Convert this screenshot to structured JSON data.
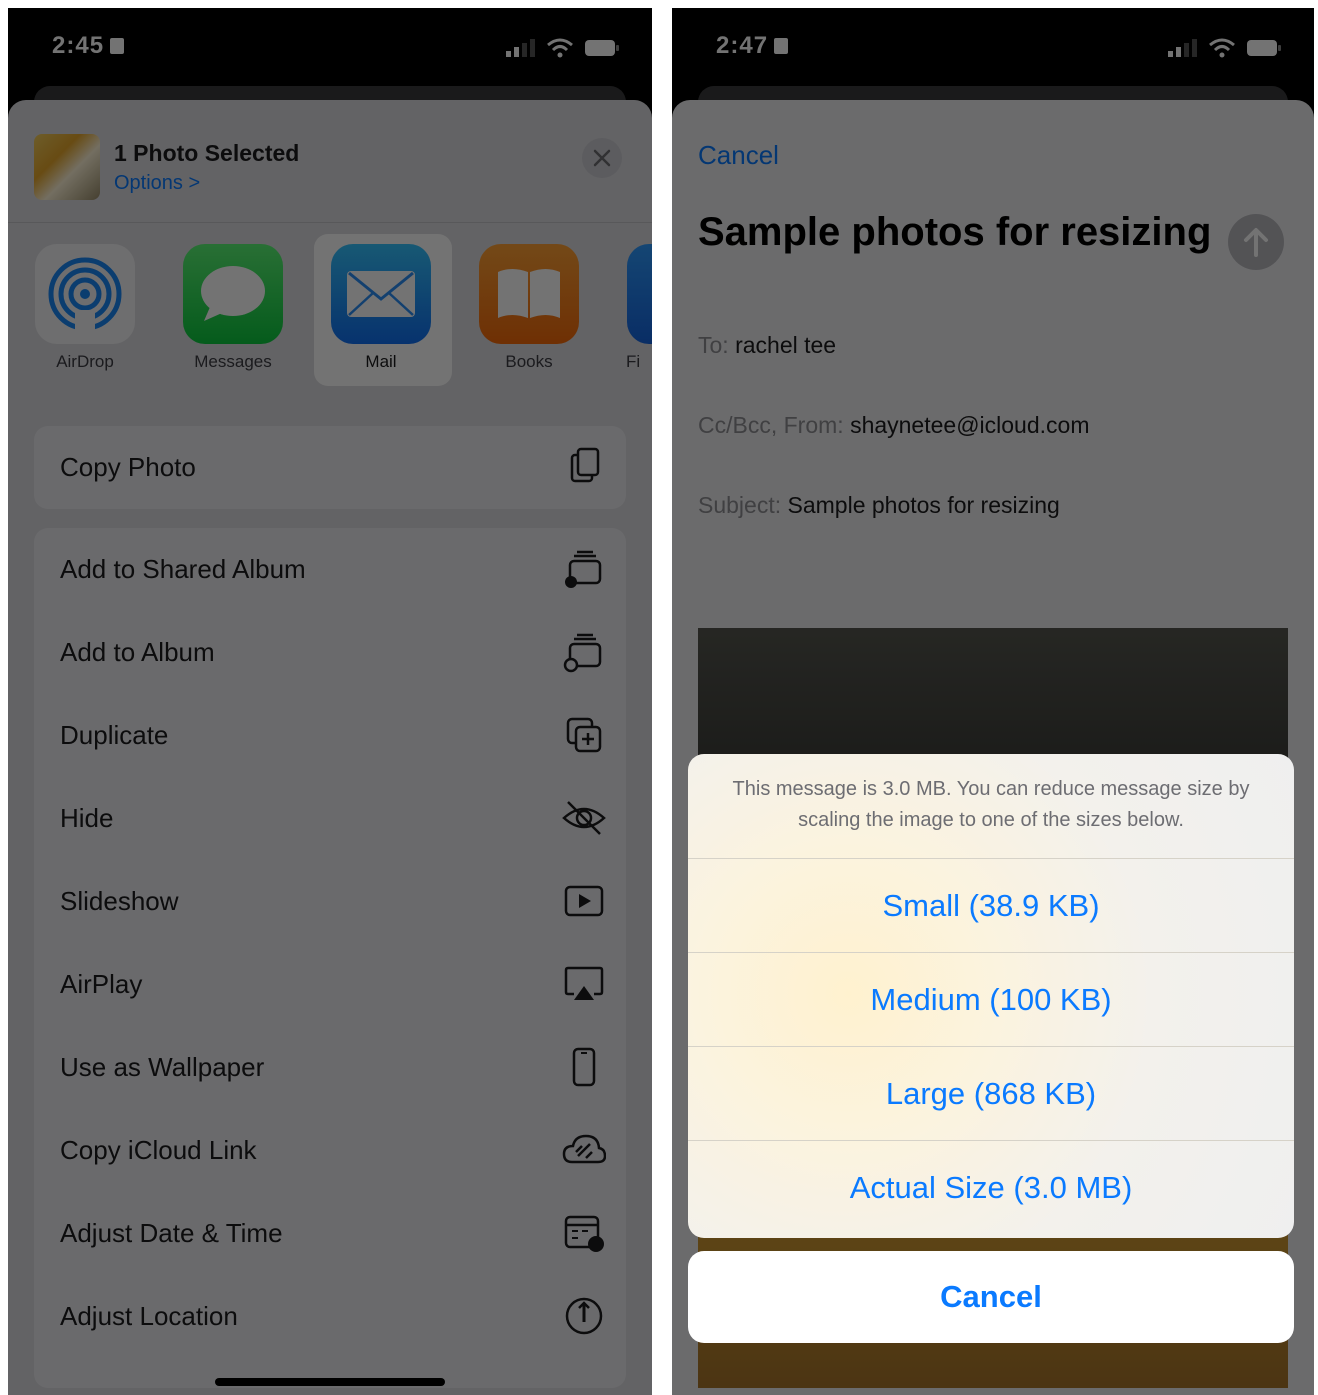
{
  "left_screen": {
    "status": {
      "time": "2:45"
    },
    "share_header": {
      "title": "1 Photo Selected",
      "options": "Options >"
    },
    "apps": [
      {
        "label": "AirDrop",
        "icon": "airdrop-icon"
      },
      {
        "label": "Messages",
        "icon": "messages-icon"
      },
      {
        "label": "Mail",
        "icon": "mail-icon",
        "selected": true
      },
      {
        "label": "Books",
        "icon": "books-icon"
      },
      {
        "label": "Fi",
        "icon": "files-icon"
      }
    ],
    "copy_photo": {
      "label": "Copy Photo",
      "icon": "copy-icon"
    },
    "actions": [
      {
        "label": "Add to Shared Album",
        "icon": "shared-album-icon"
      },
      {
        "label": "Add to Album",
        "icon": "album-icon"
      },
      {
        "label": "Duplicate",
        "icon": "duplicate-icon"
      },
      {
        "label": "Hide",
        "icon": "hide-eye-icon"
      },
      {
        "label": "Slideshow",
        "icon": "slideshow-play-icon"
      },
      {
        "label": "AirPlay",
        "icon": "airplay-icon"
      },
      {
        "label": "Use as Wallpaper",
        "icon": "phone-icon"
      },
      {
        "label": "Copy iCloud Link",
        "icon": "cloud-link-icon"
      },
      {
        "label": "Adjust Date & Time",
        "icon": "calendar-clock-icon"
      },
      {
        "label": "Adjust Location",
        "icon": "location-icon"
      }
    ]
  },
  "right_screen": {
    "status": {
      "time": "2:47"
    },
    "compose": {
      "cancel": "Cancel",
      "title": "Sample photos for resizing",
      "to_label": "To:",
      "to_value": "rachel tee",
      "ccbcc_label": "Cc/Bcc, From:",
      "from_value": "shaynetee@icloud.com",
      "subject_label": "Subject:",
      "subject_value": "Sample photos for resizing"
    },
    "resize_alert": {
      "message": "This message is 3.0 MB. You can reduce message size by scaling the image to one of the sizes below.",
      "options": [
        "Small (38.9 KB)",
        "Medium (100 KB)",
        "Large (868 KB)",
        "Actual Size (3.0 MB)"
      ],
      "cancel": "Cancel"
    }
  },
  "colors": {
    "accent": "#0A7AFF",
    "sheet": "#DCDCE0",
    "dim": "rgba(0,0,0,0.55)"
  }
}
